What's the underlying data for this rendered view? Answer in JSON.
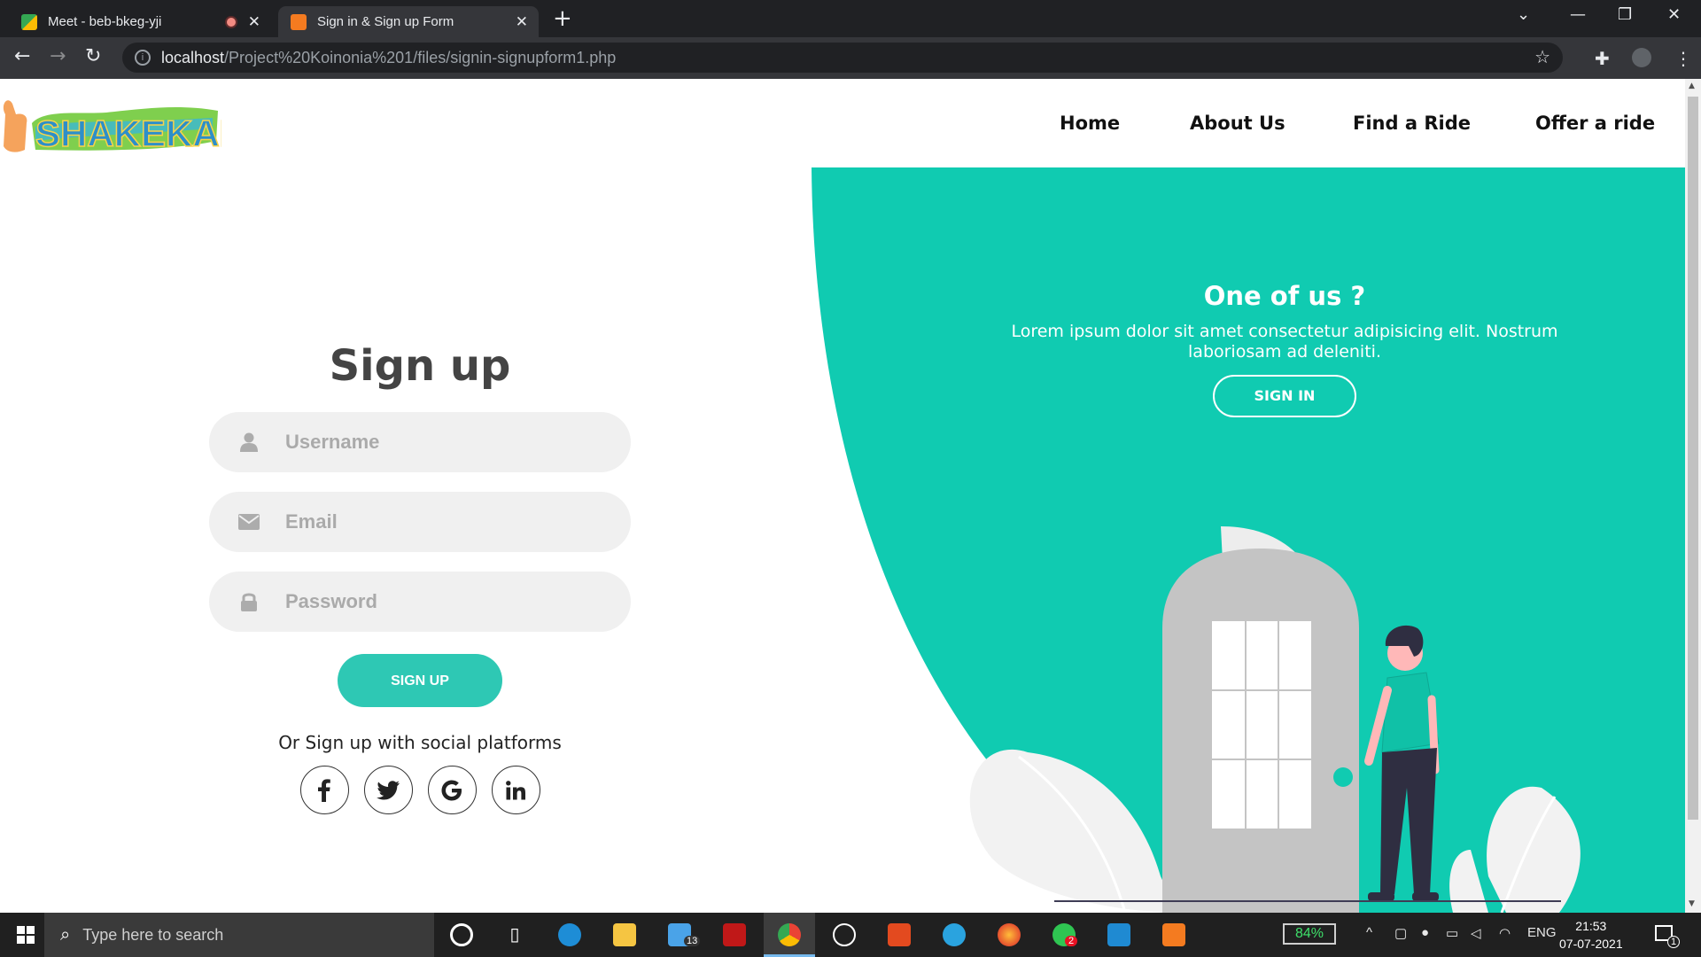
{
  "browser": {
    "tabs": [
      {
        "title": "Meet - beb-bkeg-yji",
        "active": false,
        "recording": true
      },
      {
        "title": "Sign in & Sign up Form",
        "active": true
      }
    ],
    "url_host": "localhost",
    "url_path": "/Project%20Koinonia%201/files/signin-signupform1.php"
  },
  "site": {
    "logo_text": "SHAKEKAR",
    "nav": [
      "Home",
      "About Us",
      "Find a Ride",
      "Offer a ride"
    ]
  },
  "signin_panel": {
    "title": "One of us ?",
    "text_line1": "Lorem ipsum dolor sit amet consectetur adipisicing elit. Nostrum",
    "text_line2": "laboriosam ad deleniti.",
    "button": "SIGN IN"
  },
  "signup_form": {
    "title": "Sign up",
    "username_placeholder": "Username",
    "email_placeholder": "Email",
    "password_placeholder": "Password",
    "button": "SIGN UP",
    "social_text": "Or Sign up with social platforms",
    "social": [
      "facebook-icon",
      "twitter-icon",
      "google-icon",
      "linkedin-icon"
    ]
  },
  "colors": {
    "teal": "#10cbb1",
    "button_teal": "#2ec8b4"
  },
  "taskbar": {
    "search_placeholder": "Type here to search",
    "battery": "84%",
    "language": "ENG",
    "time": "21:53",
    "date": "07-07-2021",
    "mail_badge": "13",
    "whatsapp_badge": "2",
    "notif_badge": "1"
  }
}
